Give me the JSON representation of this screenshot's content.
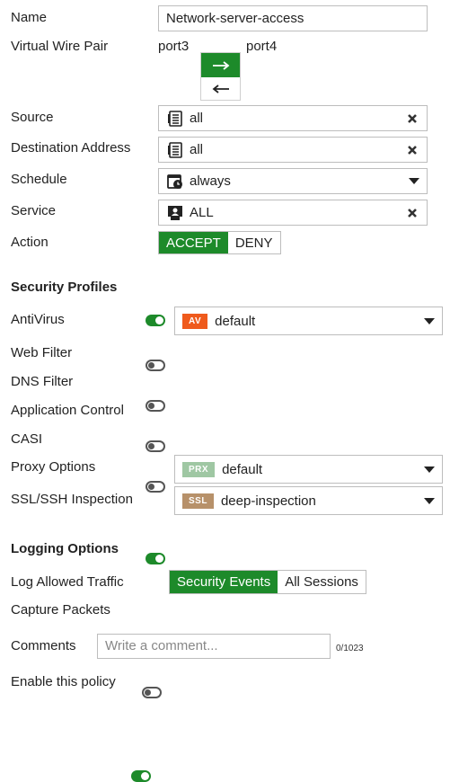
{
  "policy": {
    "name_label": "Name",
    "name_value": "Network-server-access",
    "vwp_label": "Virtual Wire Pair",
    "port_left": "port3",
    "port_right": "port4",
    "source_label": "Source",
    "source_value": "all",
    "dest_label": "Destination Address",
    "dest_value": "all",
    "schedule_label": "Schedule",
    "schedule_value": "always",
    "service_label": "Service",
    "service_value": "ALL",
    "action_label": "Action",
    "action_accept": "ACCEPT",
    "action_deny": "DENY"
  },
  "security_profiles": {
    "title": "Security Profiles",
    "antivirus_label": "AntiVirus",
    "antivirus_badge": "AV",
    "antivirus_value": "default",
    "webfilter_label": "Web Filter",
    "dnsfilter_label": "DNS Filter",
    "appcontrol_label": "Application Control",
    "casi_label": "CASI",
    "proxy_label": "Proxy Options",
    "proxy_badge": "PRX",
    "proxy_value": "default",
    "ssl_label": "SSL/SSH Inspection",
    "ssl_badge": "SSL",
    "ssl_value": "deep-inspection"
  },
  "logging": {
    "title": "Logging Options",
    "log_allowed_label": "Log Allowed Traffic",
    "security_events": "Security Events",
    "all_sessions": "All Sessions",
    "capture_label": "Capture Packets"
  },
  "comments": {
    "label": "Comments",
    "placeholder": "Write a comment...",
    "counter": "0/1023"
  },
  "enable": {
    "label": "Enable this policy"
  },
  "colors": {
    "accent": "#1d8a2a",
    "av_badge": "#ef5a1c",
    "prx_badge": "#9fc7a3",
    "ssl_badge": "#b7916a"
  }
}
